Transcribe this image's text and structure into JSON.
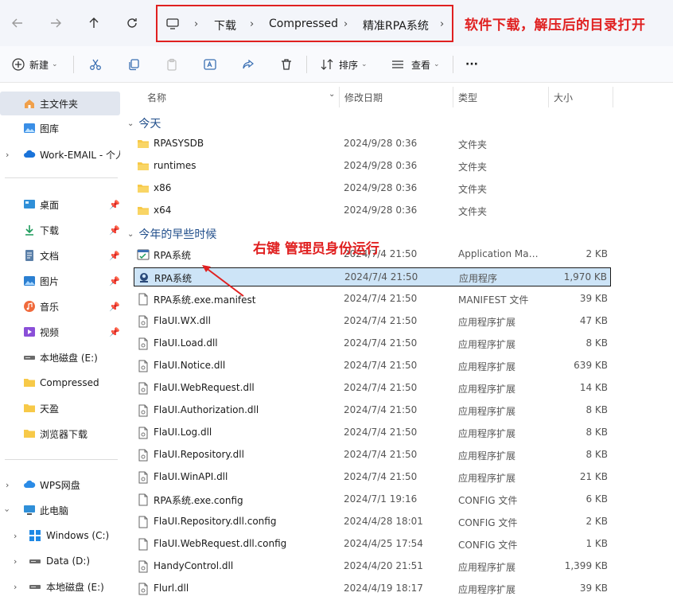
{
  "address": {
    "crumbs": [
      "下载",
      "Compressed",
      "精准RPA系统"
    ],
    "annotation": "软件下载，解压后的目录打开"
  },
  "toolbar": {
    "new_label": "新建",
    "sort_label": "排序",
    "view_label": "查看",
    "more_label": "···"
  },
  "sidebar": {
    "items": [
      {
        "label": "主文件夹"
      },
      {
        "label": "图库"
      },
      {
        "label": "Work-EMAIL - 个人"
      },
      {
        "label": "桌面"
      },
      {
        "label": "下载"
      },
      {
        "label": "文档"
      },
      {
        "label": "图片"
      },
      {
        "label": "音乐"
      },
      {
        "label": "视频"
      },
      {
        "label": "本地磁盘 (E:)"
      },
      {
        "label": "Compressed"
      },
      {
        "label": "天盈"
      },
      {
        "label": "浏览器下载"
      },
      {
        "label": "WPS网盘"
      },
      {
        "label": "此电脑"
      },
      {
        "label": "Windows (C:)"
      },
      {
        "label": "Data (D:)"
      },
      {
        "label": "本地磁盘 (E:)"
      }
    ]
  },
  "columns": {
    "name": "名称",
    "date": "修改日期",
    "type": "类型",
    "size": "大小"
  },
  "groups": {
    "today": "今天",
    "earlier": "今年的早些时候"
  },
  "annotation_mid": "右键 管理员身份运行",
  "files_today": [
    {
      "name": "RPASYSDB",
      "date": "2024/9/28 0:36",
      "type": "文件夹",
      "size": ""
    },
    {
      "name": "runtimes",
      "date": "2024/9/28 0:36",
      "type": "文件夹",
      "size": ""
    },
    {
      "name": "x86",
      "date": "2024/9/28 0:36",
      "type": "文件夹",
      "size": ""
    },
    {
      "name": "x64",
      "date": "2024/9/28 0:36",
      "type": "文件夹",
      "size": ""
    }
  ],
  "files_earlier": [
    {
      "name": "RPA系统",
      "date": "2024/7/4 21:50",
      "type": "Application Manifest",
      "size": "2 KB"
    },
    {
      "name": "RPA系统",
      "date": "2024/7/4 21:50",
      "type": "应用程序",
      "size": "1,970 KB"
    },
    {
      "name": "RPA系统.exe.manifest",
      "date": "2024/7/4 21:50",
      "type": "MANIFEST 文件",
      "size": "39 KB"
    },
    {
      "name": "FlaUI.WX.dll",
      "date": "2024/7/4 21:50",
      "type": "应用程序扩展",
      "size": "47 KB"
    },
    {
      "name": "FlaUI.Load.dll",
      "date": "2024/7/4 21:50",
      "type": "应用程序扩展",
      "size": "8 KB"
    },
    {
      "name": "FlaUI.Notice.dll",
      "date": "2024/7/4 21:50",
      "type": "应用程序扩展",
      "size": "639 KB"
    },
    {
      "name": "FlaUI.WebRequest.dll",
      "date": "2024/7/4 21:50",
      "type": "应用程序扩展",
      "size": "14 KB"
    },
    {
      "name": "FlaUI.Authorization.dll",
      "date": "2024/7/4 21:50",
      "type": "应用程序扩展",
      "size": "8 KB"
    },
    {
      "name": "FlaUI.Log.dll",
      "date": "2024/7/4 21:50",
      "type": "应用程序扩展",
      "size": "8 KB"
    },
    {
      "name": "FlaUI.Repository.dll",
      "date": "2024/7/4 21:50",
      "type": "应用程序扩展",
      "size": "8 KB"
    },
    {
      "name": "FlaUI.WinAPI.dll",
      "date": "2024/7/4 21:50",
      "type": "应用程序扩展",
      "size": "21 KB"
    },
    {
      "name": "RPA系统.exe.config",
      "date": "2024/7/1 19:16",
      "type": "CONFIG 文件",
      "size": "6 KB"
    },
    {
      "name": "FlaUI.Repository.dll.config",
      "date": "2024/4/28 18:01",
      "type": "CONFIG 文件",
      "size": "2 KB"
    },
    {
      "name": "FlaUI.WebRequest.dll.config",
      "date": "2024/4/25 17:54",
      "type": "CONFIG 文件",
      "size": "1 KB"
    },
    {
      "name": "HandyControl.dll",
      "date": "2024/4/20 21:51",
      "type": "应用程序扩展",
      "size": "1,399 KB"
    },
    {
      "name": "Flurl.dll",
      "date": "2024/4/19 18:17",
      "type": "应用程序扩展",
      "size": "39 KB"
    }
  ],
  "colors": {
    "accent_red": "#e02020",
    "selection_bg": "#cde4f7",
    "folder_yellow": "#f7c948",
    "group_blue": "#1f4d8a"
  }
}
